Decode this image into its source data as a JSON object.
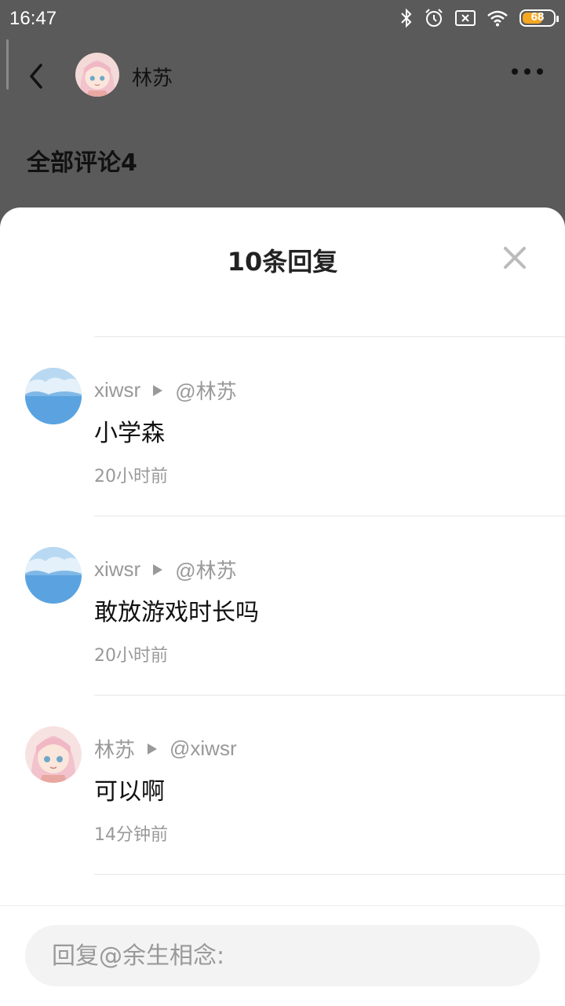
{
  "status_bar": {
    "time": "16:47",
    "battery": "68",
    "battery_fraction": 0.68,
    "icons": [
      "bluetooth-icon",
      "alarm-icon",
      "sim-off-icon",
      "wifi-icon",
      "battery-icon"
    ]
  },
  "top_nav": {
    "title": "林苏",
    "icons": [
      "back-arrow-icon",
      "more-dots-icon"
    ]
  },
  "background": {
    "section_title": "全部评论4"
  },
  "sheet": {
    "title": "10条回复",
    "close_icon": "close-icon"
  },
  "replies": [
    {
      "user": "xiwsr",
      "target": "@林苏",
      "text": "小学森",
      "time": "20小时前",
      "avatar": "sky-avatar"
    },
    {
      "user": "xiwsr",
      "target": "@林苏",
      "text": "敢放游戏时长吗",
      "time": "20小时前",
      "avatar": "sky-avatar"
    },
    {
      "user": "林苏",
      "target": "@xiwsr",
      "text": "可以啊",
      "time": "14分钟前",
      "avatar": "anime-girl-avatar"
    }
  ],
  "input": {
    "placeholder": "回复@余生相念:"
  },
  "colors": {
    "overlay": "#5a5a5a",
    "sheet_bg": "#ffffff",
    "input_bg": "#f3f3f3",
    "muted_text": "#999999",
    "battery_accent": "#f5a623"
  }
}
